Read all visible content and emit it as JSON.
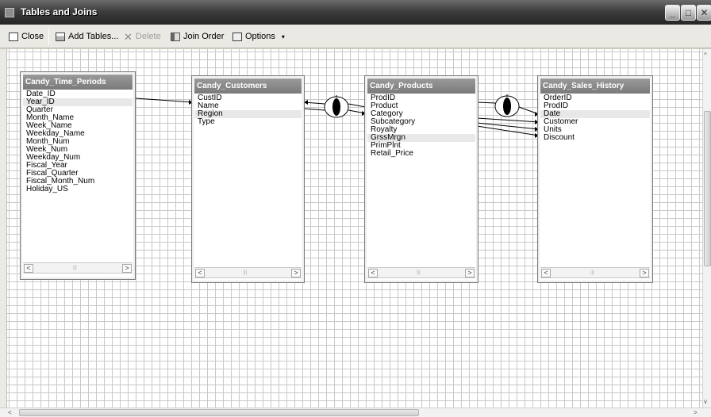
{
  "window": {
    "title": "Tables and Joins",
    "controls": {
      "minimize": "_",
      "maximize": "□",
      "close": "✕"
    }
  },
  "toolbar": {
    "close_label": "Close",
    "add_tables_label": "Add Tables...",
    "delete_label": "Delete",
    "join_order_label": "Join Order",
    "options_label": "Options",
    "options_caret": "▾"
  },
  "tables": [
    {
      "name": "Candy_Time_Periods",
      "fields": [
        "Date_ID",
        "Year_ID",
        "Quarter",
        "Month_Name",
        "Week_Name",
        "Weekday_Name",
        "Month_Num",
        "Week_Num",
        "Weekday_Num",
        "Fiscal_Year",
        "Fiscal_Quarter",
        "Fiscal_Month_Num",
        "Holiday_US"
      ],
      "highlighted_field": "Year_ID"
    },
    {
      "name": "Candy_Customers",
      "fields": [
        "CustID",
        "Name",
        "Region",
        "Type"
      ],
      "highlighted_field": "Region"
    },
    {
      "name": "Candy_Products",
      "fields": [
        "ProdID",
        "Product",
        "Category",
        "Subcategory",
        "Royalty",
        "GrssMrgn",
        "PrimPlnt",
        "Retail_Price"
      ],
      "highlighted_field": "GrssMrgn"
    },
    {
      "name": "Candy_Sales_History",
      "fields": [
        "OrderID",
        "ProdID",
        "Date",
        "Customer",
        "Units",
        "Discount"
      ],
      "highlighted_field": "Date"
    }
  ],
  "scroll_glyphs": {
    "left": "<",
    "right": ">",
    "up": "^",
    "down": "v",
    "grip": "|||"
  },
  "colors": {
    "title_bar": "#3e3e3e",
    "table_header": "#8a8a8a",
    "grid_line": "#c9c9c9"
  }
}
